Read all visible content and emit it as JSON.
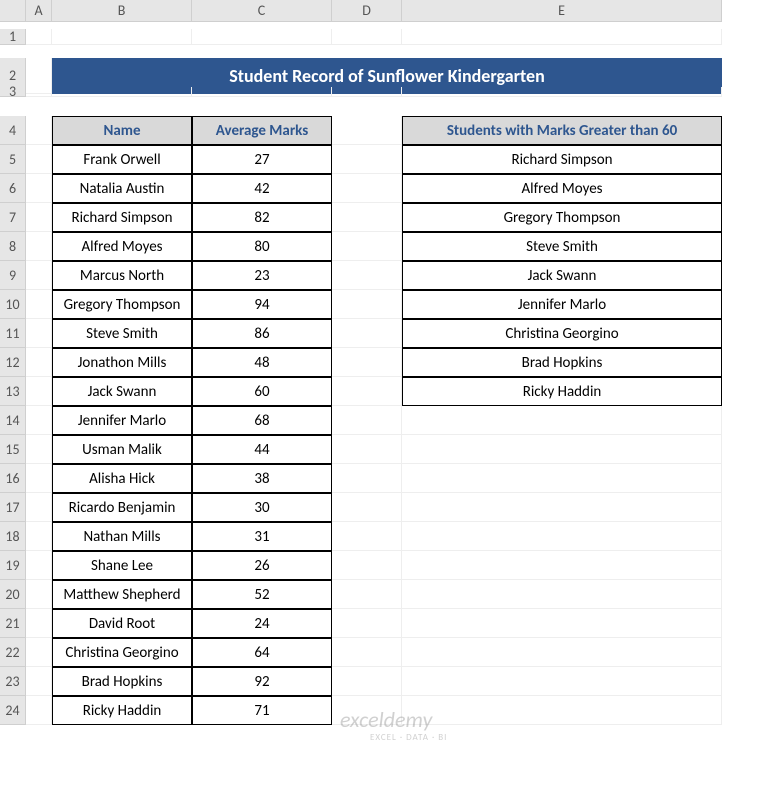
{
  "columns": {
    "A": "A",
    "B": "B",
    "C": "C",
    "D": "D",
    "E": "E"
  },
  "title": "Student Record of Sunflower Kindergarten",
  "table1": {
    "header_name": "Name",
    "header_marks": "Average Marks",
    "rows": [
      {
        "name": "Frank Orwell",
        "marks": "27"
      },
      {
        "name": "Natalia Austin",
        "marks": "42"
      },
      {
        "name": "Richard Simpson",
        "marks": "82"
      },
      {
        "name": "Alfred Moyes",
        "marks": "80"
      },
      {
        "name": "Marcus North",
        "marks": "23"
      },
      {
        "name": "Gregory Thompson",
        "marks": "94"
      },
      {
        "name": "Steve Smith",
        "marks": "86"
      },
      {
        "name": "Jonathon Mills",
        "marks": "48"
      },
      {
        "name": "Jack Swann",
        "marks": "60"
      },
      {
        "name": "Jennifer Marlo",
        "marks": "68"
      },
      {
        "name": "Usman Malik",
        "marks": "44"
      },
      {
        "name": "Alisha Hick",
        "marks": "38"
      },
      {
        "name": "Ricardo Benjamin",
        "marks": "30"
      },
      {
        "name": "Nathan Mills",
        "marks": "31"
      },
      {
        "name": "Shane Lee",
        "marks": "26"
      },
      {
        "name": "Matthew Shepherd",
        "marks": "52"
      },
      {
        "name": "David Root",
        "marks": "24"
      },
      {
        "name": "Christina Georgino",
        "marks": "64"
      },
      {
        "name": "Brad Hopkins",
        "marks": "92"
      },
      {
        "name": "Ricky Haddin",
        "marks": "71"
      }
    ]
  },
  "table2": {
    "header": "Students with Marks Greater than 60",
    "rows": [
      "Richard Simpson",
      "Alfred Moyes",
      "Gregory Thompson",
      "Steve Smith",
      "Jack Swann",
      "Jennifer Marlo",
      "Christina Georgino",
      "Brad Hopkins",
      "Ricky Haddin"
    ]
  },
  "watermark": "exceldemy",
  "watermark_sub": "EXCEL · DATA · BI",
  "row_numbers": [
    "1",
    "2",
    "3",
    "4",
    "5",
    "6",
    "7",
    "8",
    "9",
    "10",
    "11",
    "12",
    "13",
    "14",
    "15",
    "16",
    "17",
    "18",
    "19",
    "20",
    "21",
    "22",
    "23",
    "24"
  ]
}
